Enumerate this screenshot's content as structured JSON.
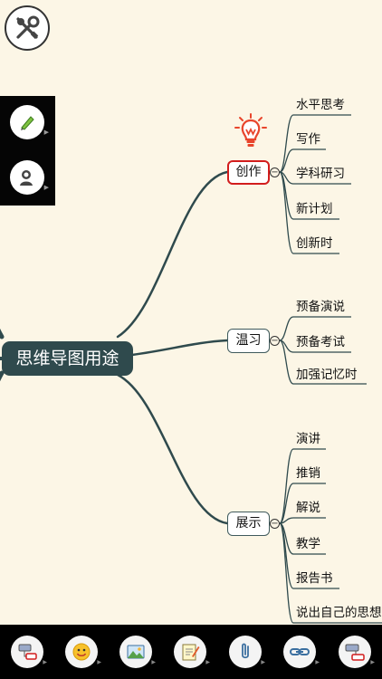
{
  "mindmap": {
    "central_topic": "思维导图用途",
    "branches": [
      {
        "label": "创作",
        "selected": true,
        "icon": "lightbulb-icon",
        "children": [
          "水平思考",
          "写作",
          "学科研习",
          "新计划",
          "创新时"
        ]
      },
      {
        "label": "温习",
        "selected": false,
        "children": [
          "预备演说",
          "预备考试",
          "加强记忆时"
        ]
      },
      {
        "label": "展示",
        "selected": false,
        "children": [
          "演讲",
          "推销",
          "解说",
          "教学",
          "报告书",
          "说出自己的思想"
        ]
      }
    ],
    "collapse_symbol": "−"
  },
  "colors": {
    "background": "#fcf6e6",
    "central_fill": "#2f4a4d",
    "connector": "#2f4a4d",
    "selected_border": "#d21d1d",
    "bulb": "#e8452c",
    "panel": "#000000"
  },
  "side_panel": {
    "tools": [
      {
        "icon": "pencil-icon"
      },
      {
        "icon": "presenter-icon"
      }
    ]
  },
  "toolbar": {
    "tools": [
      {
        "icon": "add-topic-icon"
      },
      {
        "icon": "emoji-icon"
      },
      {
        "icon": "image-icon"
      },
      {
        "icon": "note-icon"
      },
      {
        "icon": "attachment-icon"
      },
      {
        "icon": "link-icon"
      },
      {
        "icon": "add-subtopic-icon"
      }
    ]
  }
}
